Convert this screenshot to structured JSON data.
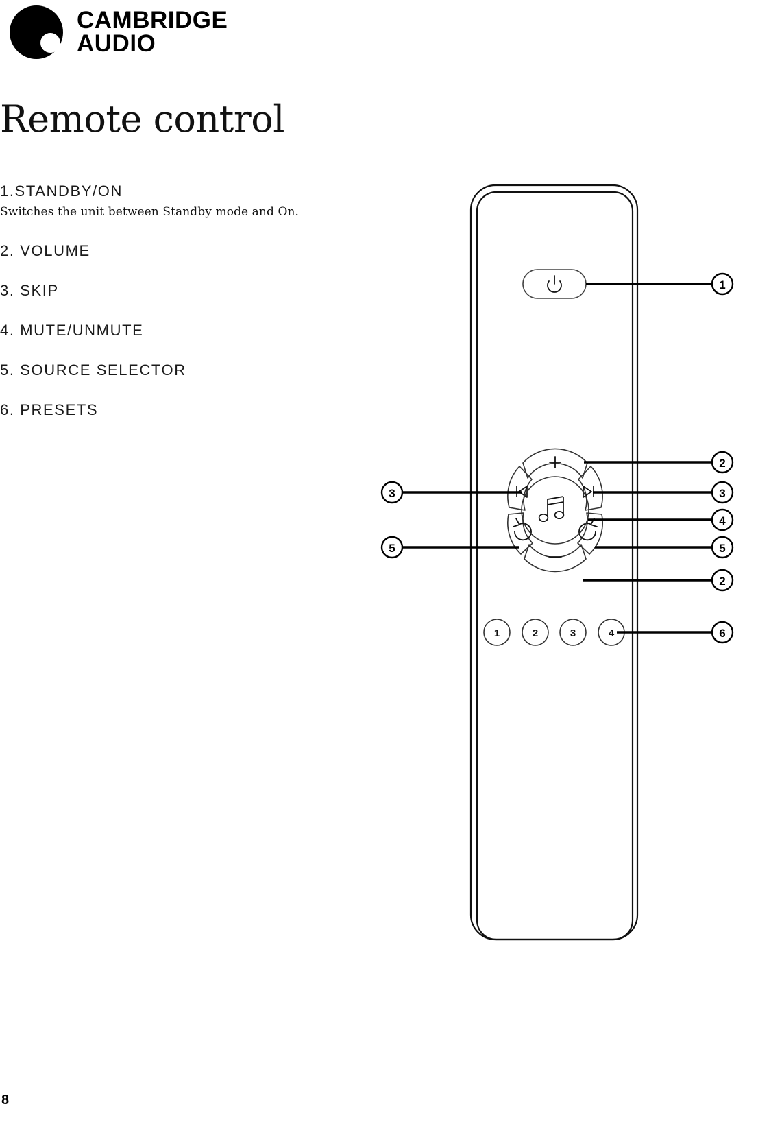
{
  "brand": {
    "line1": "CAMBRIDGE",
    "line2": "AUDIO",
    "logo_icon": "cambridge-audio-disc-logo"
  },
  "page": {
    "title": "Remote control",
    "number": "8"
  },
  "legend": {
    "items": [
      {
        "head": "1.STANDBY/ON",
        "desc": "Switches the unit between Standby mode and On."
      },
      {
        "head": "2. VOLUME",
        "desc": ""
      },
      {
        "head": "3. SKIP",
        "desc": ""
      },
      {
        "head": "4. MUTE/UNMUTE",
        "desc": ""
      },
      {
        "head": "5. SOURCE SELECTOR",
        "desc": ""
      },
      {
        "head": "6. PRESETS",
        "desc": ""
      }
    ]
  },
  "remote": {
    "power_button_icon": "power-standby-icon",
    "volume_up_label": "+",
    "volume_down_label": "−",
    "skip_back_icon": "skip-previous-icon",
    "skip_forward_icon": "skip-next-icon",
    "mute_icon": "mute-unmute-rotate-icon",
    "source_icon": "source-selector-rotate-icon",
    "center_icon": "music-note-icon",
    "presets": [
      "1",
      "2",
      "3",
      "4"
    ]
  },
  "callouts": {
    "left": [
      {
        "label": "3",
        "target": "skip-back-button"
      },
      {
        "label": "5",
        "target": "mute-button"
      }
    ],
    "right": [
      {
        "label": "1",
        "target": "power-button"
      },
      {
        "label": "2",
        "target": "volume-up-button"
      },
      {
        "label": "3",
        "target": "skip-forward-button"
      },
      {
        "label": "4",
        "target": "center-music-button"
      },
      {
        "label": "5",
        "target": "source-selector-button"
      },
      {
        "label": "2",
        "target": "volume-down-button"
      },
      {
        "label": "6",
        "target": "preset-button-4"
      }
    ]
  },
  "colors": {
    "ink": "#111111",
    "line": "#000000",
    "outline": "#1a1a1a",
    "paper": "#ffffff"
  }
}
